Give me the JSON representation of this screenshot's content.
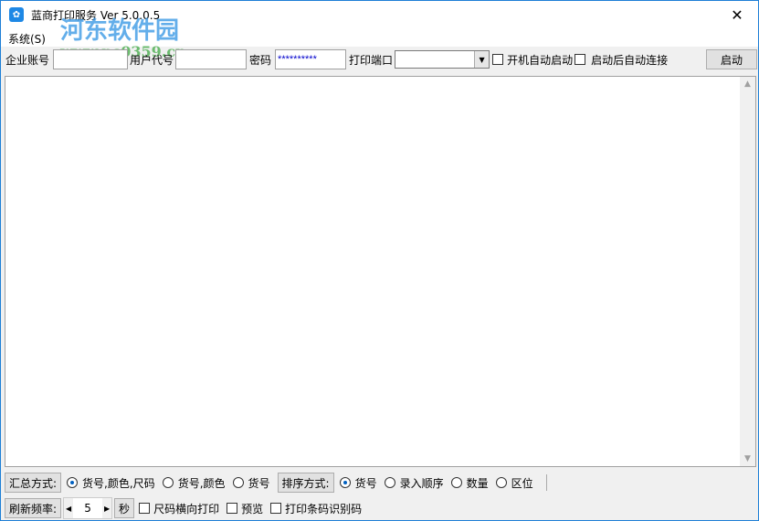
{
  "window": {
    "title": "蓝商打印服务 Ver 5.0.0.5",
    "close": "✕"
  },
  "menu": {
    "system": "系统(S)"
  },
  "watermark": {
    "name": "河东软件园",
    "url": "www.pc0359.cn"
  },
  "toolbar": {
    "account_label": "企业账号",
    "account_value": "",
    "user_label": "用户代号",
    "user_value": "",
    "password_label": "密码",
    "password_value": "**********",
    "port_label": "打印端口",
    "port_value": "",
    "autostart_label": "开机自动启动",
    "autostart_checked": false,
    "autoconnect_label": "启动后自动连接",
    "autoconnect_checked": false,
    "start_button": "启动"
  },
  "summary": {
    "label": "汇总方式:",
    "options": [
      "货号,颜色,尺码",
      "货号,颜色",
      "货号"
    ],
    "selected": 0
  },
  "sort": {
    "label": "排序方式:",
    "options": [
      "货号",
      "录入顺序",
      "数量",
      "区位"
    ],
    "selected": 0
  },
  "refresh": {
    "label": "刷新频率:",
    "value": "5",
    "unit": "秒"
  },
  "options": {
    "horizontal_label": "尺码横向打印",
    "preview_label": "预览",
    "barcode_label": "打印条码识别码"
  }
}
